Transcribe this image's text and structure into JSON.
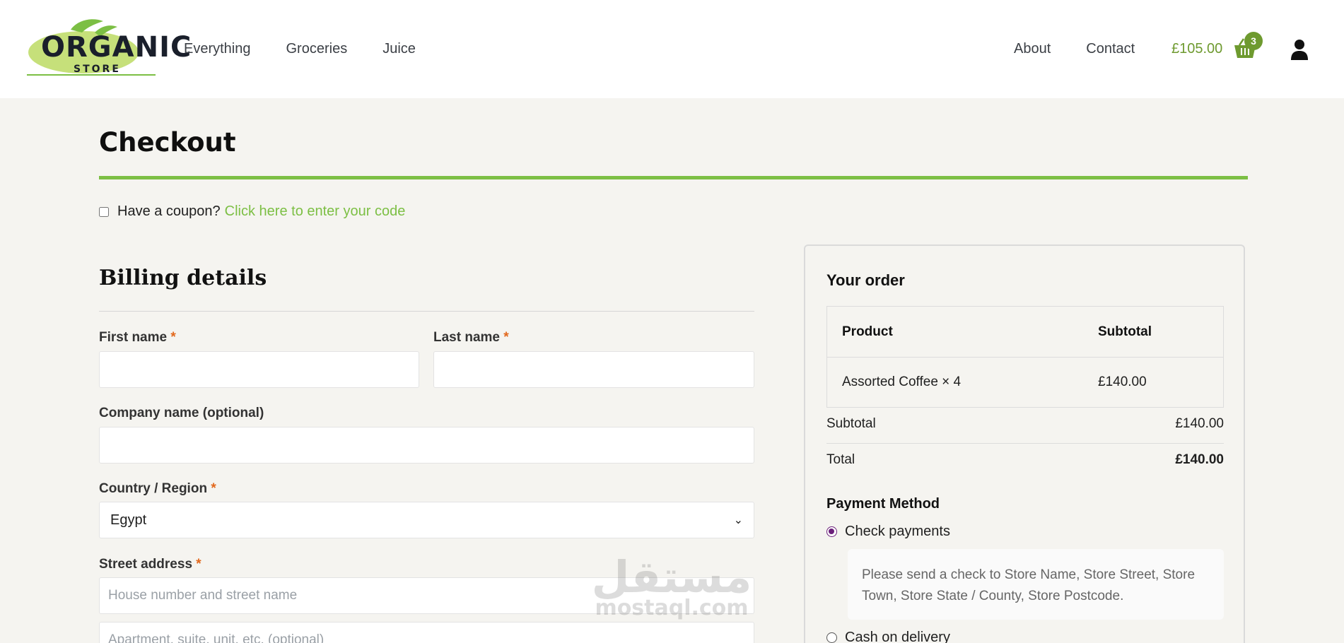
{
  "header": {
    "logo": {
      "word": "ORGANIC",
      "sub": "STORE"
    },
    "nav_left": [
      "Everything",
      "Groceries",
      "Juice"
    ],
    "nav_right": [
      "About",
      "Contact"
    ],
    "cart_total": "£105.00",
    "cart_count": "3"
  },
  "page": {
    "title": "Checkout",
    "coupon_prompt": "Have a coupon?",
    "coupon_link": "Click here to enter your code"
  },
  "billing": {
    "title": "Billing details",
    "first_name_label": "First name",
    "last_name_label": "Last name",
    "company_label": "Company name (optional)",
    "country_label": "Country / Region",
    "country_value": "Egypt",
    "street_label": "Street address",
    "street_placeholder": "House number and street name",
    "street2_placeholder": "Apartment, suite, unit, etc. (optional)",
    "required_mark": "*"
  },
  "order": {
    "title": "Your order",
    "col_product": "Product",
    "col_subtotal": "Subtotal",
    "item_name": "Assorted Coffee × 4",
    "item_subtotal": "£140.00",
    "subtotal_label": "Subtotal",
    "subtotal_value": "£140.00",
    "total_label": "Total",
    "total_value": "£140.00",
    "payment_title": "Payment Method",
    "payment_check": "Check payments",
    "payment_check_desc": "Please send a check to Store Name, Store Street, Store Town, Store State / County, Store Postcode.",
    "payment_cod": "Cash on delivery"
  },
  "watermark": {
    "arabic": "مستقل",
    "latin": "mostaql.com"
  },
  "colors": {
    "accent": "#7cbf44",
    "brand_green": "#6e9a2f",
    "required": "#e2681d",
    "radio": "#6b1f7a"
  }
}
